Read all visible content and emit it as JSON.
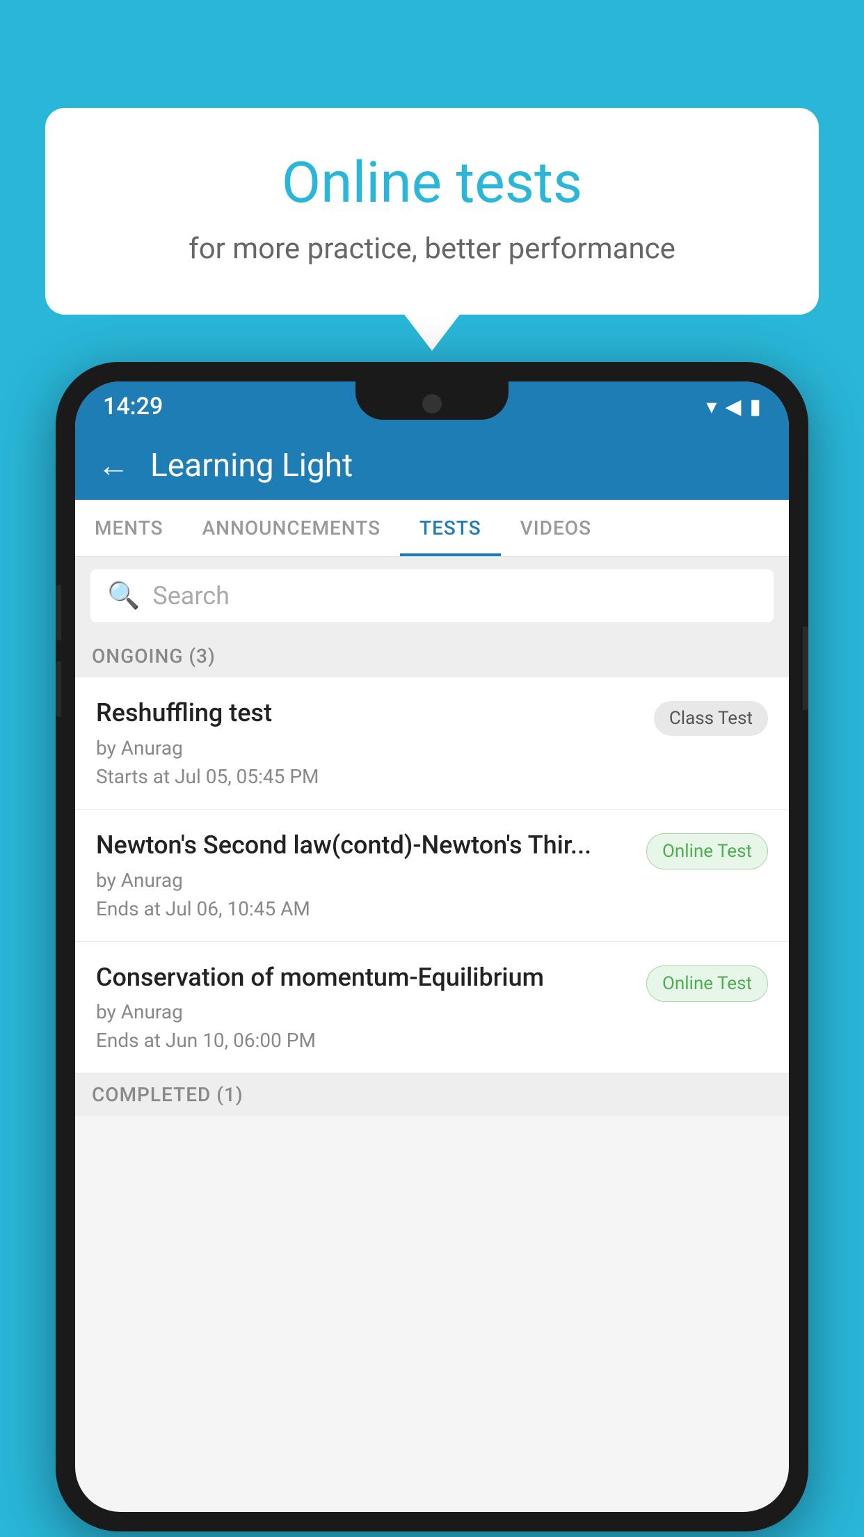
{
  "background_color": "#29b6d8",
  "bubble": {
    "title": "Online tests",
    "subtitle": "for more practice, better performance"
  },
  "phone": {
    "status_bar": {
      "time": "14:29",
      "icons": [
        "wifi",
        "signal",
        "battery"
      ]
    },
    "header": {
      "title": "Learning Light",
      "back_label": "←"
    },
    "tabs": [
      {
        "label": "MENTS",
        "active": false
      },
      {
        "label": "ANNOUNCEMENTS",
        "active": false
      },
      {
        "label": "TESTS",
        "active": true
      },
      {
        "label": "VIDEOS",
        "active": false
      }
    ],
    "search": {
      "placeholder": "Search"
    },
    "ongoing_section": {
      "label": "ONGOING (3)"
    },
    "tests": [
      {
        "name": "Reshuffling test",
        "author": "by Anurag",
        "time": "Starts at  Jul 05, 05:45 PM",
        "badge": "Class Test",
        "badge_type": "class"
      },
      {
        "name": "Newton's Second law(contd)-Newton's Thir...",
        "author": "by Anurag",
        "time": "Ends at  Jul 06, 10:45 AM",
        "badge": "Online Test",
        "badge_type": "online"
      },
      {
        "name": "Conservation of momentum-Equilibrium",
        "author": "by Anurag",
        "time": "Ends at  Jun 10, 06:00 PM",
        "badge": "Online Test",
        "badge_type": "online"
      }
    ],
    "completed_section": {
      "label": "COMPLETED (1)"
    }
  }
}
